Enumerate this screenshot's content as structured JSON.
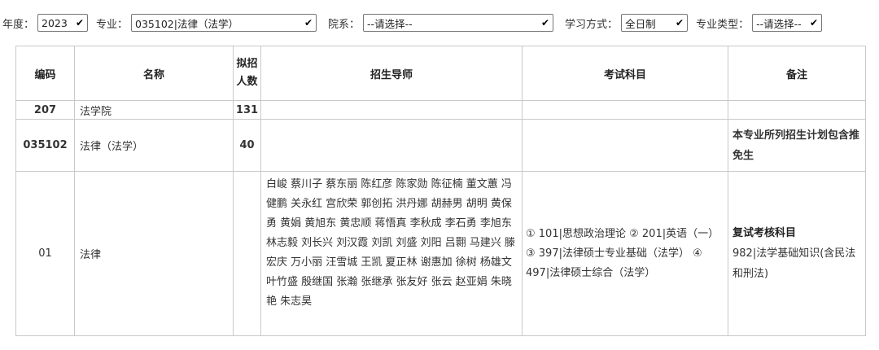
{
  "filters": {
    "year_label": "年度：",
    "year_value": "2023",
    "major_label": "专业：",
    "major_value": "035102|法律（法学）",
    "dept_label": "院系：",
    "dept_value": "--请选择--",
    "mode_label": "学习方式：",
    "mode_value": "全日制",
    "type_label": "专业类型：",
    "type_value": "--请选择--"
  },
  "table": {
    "headers": {
      "code": "编码",
      "name": "名称",
      "quota_line1": "拟招",
      "quota_line2": "人数",
      "mentors": "招生导师",
      "exam": "考试科目",
      "note": "备注"
    },
    "rows": [
      {
        "code": "207",
        "name": "法学院",
        "quota": "131",
        "mentors": "",
        "exam": "",
        "note": ""
      },
      {
        "code": "035102",
        "name": "法律（法学）",
        "quota": "40",
        "mentors": "",
        "exam": "",
        "note": "本专业所列招生计划包含推免生"
      },
      {
        "code": "01",
        "name": "法律",
        "quota": "",
        "mentors": "白峻 蔡川子 蔡东丽 陈红彦 陈家勋 陈征楠 董文蕙 冯健鹏 关永红 宫欣荣 郭创拓 洪丹娜 胡赫男 胡明 黄保勇 黄娟 黄旭东 黄忠顺 蒋悟真 李秋成 李石勇 李旭东 林志毅 刘长兴 刘汉霞 刘凯 刘盛 刘阳 吕翾 马建兴 滕宏庆 万小丽 汪雪城 王凯 夏正林 谢惠加 徐树 杨雄文 叶竹盛 殷继国 张瀚 张继承 张友好 张云 赵亚娟 朱晓艳 朱志昊",
        "exam": "① 101|思想政治理论 ② 201|英语（一） ③ 397|法律硕士专业基础（法学） ④ 497|法律硕士综合（法学）",
        "note_title": "复试考核科目",
        "note_body": " 982|法学基础知识(含民法和刑法)"
      }
    ]
  }
}
